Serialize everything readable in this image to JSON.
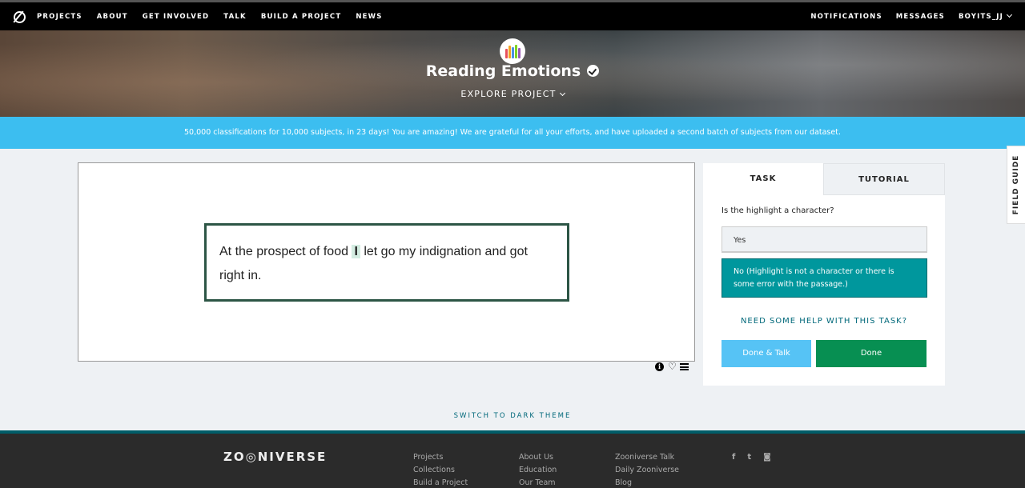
{
  "nav": {
    "left": [
      "PROJECTS",
      "ABOUT",
      "GET INVOLVED",
      "TALK",
      "BUILD A PROJECT",
      "NEWS"
    ],
    "right": [
      "NOTIFICATIONS",
      "MESSAGES",
      "BOYITS_JJ"
    ]
  },
  "hero": {
    "title": "Reading Emotions",
    "explore": "EXPLORE PROJECT",
    "avatar_bar_colors": [
      "#e8505b",
      "#f5a623",
      "#4a90e2",
      "#7ed321",
      "#9b59b6"
    ]
  },
  "announcement": "50,000 classifications for 10,000 subjects, in 23 days! You are amazing! We are grateful for all your efforts, and have uploaded a second batch of subjects from our dataset.",
  "subject": {
    "text_before": "At the prospect of food ",
    "highlight": "I",
    "text_after": " let go my indignation and got right in."
  },
  "task": {
    "tabs": [
      "TASK",
      "TUTORIAL"
    ],
    "question": "Is the highlight a character?",
    "answers": [
      "Yes",
      "No (Highlight is not a character or there is some error with the passage.)"
    ],
    "help": "NEED SOME HELP WITH THIS TASK?",
    "done_talk": "Done & Talk",
    "done": "Done"
  },
  "field_guide": "FIELD GUIDE",
  "dark_theme": "SWITCH TO DARK THEME",
  "footer": {
    "logo": "ZO◎NIVERSE",
    "col1": [
      "Projects",
      "Collections",
      "Build a Project"
    ],
    "col2": [
      "About Us",
      "Education",
      "Our Team"
    ],
    "col3": [
      "Zooniverse Talk",
      "Daily Zooniverse",
      "Blog"
    ],
    "social": [
      "f",
      "t",
      "◙"
    ]
  },
  "colors": {
    "announcement_bg": "#3cbef0",
    "answer_selected": "#00979d",
    "done": "#078f52",
    "done_talk": "#56c3f5",
    "accent_teal": "#00687a"
  }
}
